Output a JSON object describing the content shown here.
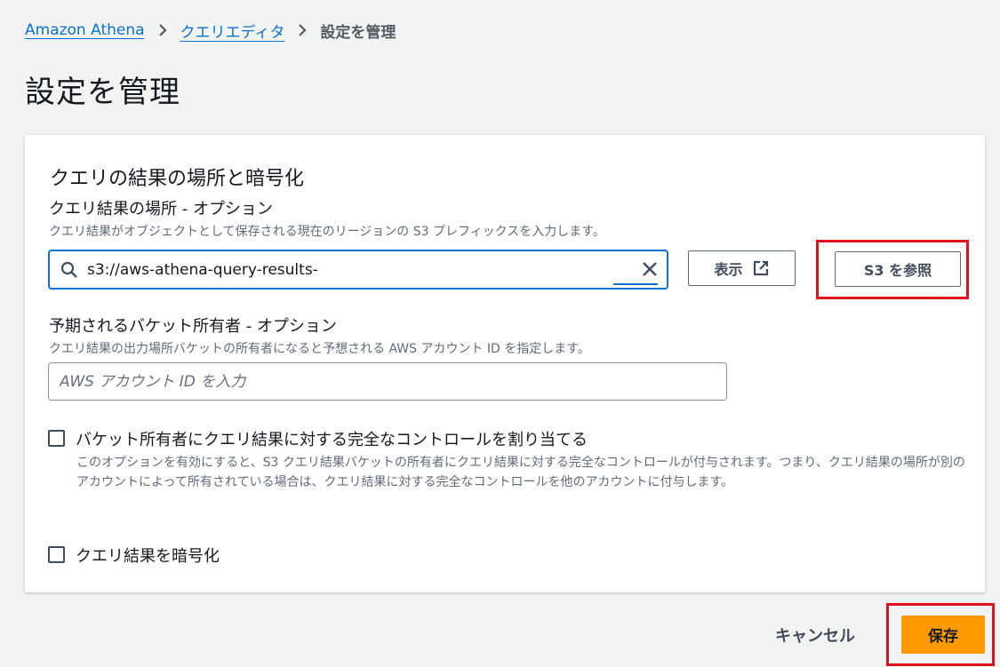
{
  "breadcrumb": {
    "root": "Amazon Athena",
    "parent": "クエリエディタ",
    "current": "設定を管理"
  },
  "page_title": "設定を管理",
  "panel": {
    "section_title": "クエリの結果の場所と暗号化",
    "location": {
      "label": "クエリ結果の場所 - オプション",
      "description": "クエリ結果がオブジェクトとして保存される現在のリージョンの S3 プレフィックスを入力します。",
      "value": "s3://aws-athena-query-results-",
      "view_button": "表示",
      "browse_button": "S3 を参照"
    },
    "owner": {
      "label": "予期されるバケット所有者 - オプション",
      "description": "クエリ結果の出力場所バケットの所有者になると予想される AWS アカウント ID を指定します。",
      "placeholder": "AWS アカウント ID を入力"
    },
    "full_control": {
      "label": "バケット所有者にクエリ結果に対する完全なコントロールを割り当てる",
      "description": "このオプションを有効にすると、S3 クエリ結果バケットの所有者にクエリ結果に対する完全なコントロールが付与されます。つまり、クエリ結果の場所が別のアカウントによって所有されている場合は、クエリ結果に対する完全なコントロールを他のアカウントに付与します。",
      "checked": false
    },
    "encrypt": {
      "label": "クエリ結果を暗号化",
      "checked": false
    }
  },
  "footer": {
    "cancel": "キャンセル",
    "save": "保存"
  },
  "colors": {
    "link": "#0972d3",
    "primary": "#ff9900",
    "highlight": "#e0111d"
  }
}
